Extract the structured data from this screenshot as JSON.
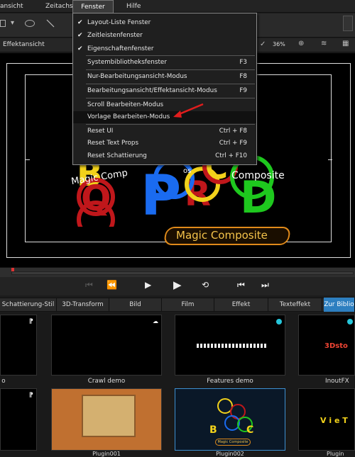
{
  "menubar": {
    "items": [
      "ansicht",
      "Zeitachse",
      "Fenster",
      "Hilfe"
    ],
    "active": "Fenster"
  },
  "tabbar": {
    "title": "Effektansicht",
    "zoom": "36%"
  },
  "dropdown": {
    "items": [
      {
        "label": "Layout-Liste Fenster",
        "checked": true,
        "shortcut": ""
      },
      {
        "label": "Zeitleistenfenster",
        "checked": true,
        "shortcut": ""
      },
      {
        "label": "Eigenschaftenfenster",
        "checked": true,
        "shortcut": ""
      },
      {
        "label": "Systembibliotheksfenster",
        "checked": false,
        "shortcut": "F3"
      },
      {
        "label": "Nur-Bearbeitungsansicht-Modus",
        "checked": false,
        "shortcut": "F8"
      },
      {
        "label": "Bearbeitungsansicht/Effektansicht-Modus",
        "checked": false,
        "shortcut": "F9"
      },
      {
        "label": "Scroll Bearbeiten-Modus",
        "checked": false,
        "shortcut": ""
      },
      {
        "label": "Vorlage Bearbeiten-Modus",
        "checked": false,
        "shortcut": ""
      },
      {
        "label": "Reset UI",
        "checked": false,
        "shortcut": "Ctrl + F8"
      },
      {
        "label": "Reset Text Props",
        "checked": false,
        "shortcut": "Ctrl + F9"
      },
      {
        "label": "Reset Schattierung",
        "checked": false,
        "shortcut": "Ctrl + F10"
      }
    ]
  },
  "preview": {
    "curve_text_left": "Magic Comp",
    "curve_text_mid": "os",
    "curve_text_right": "Composite",
    "banner_text": "Magic Composite",
    "letters": [
      "B",
      "C",
      "Q",
      "P",
      "R",
      "D"
    ]
  },
  "categories": [
    "Schattierung-Stil",
    "3D-Transform",
    "Bild",
    "Film",
    "Effekt",
    "Texteffekt",
    "Zur Biblio"
  ],
  "gallery": {
    "row1": [
      "o",
      "Crawl demo",
      "Features demo",
      "InoutFX"
    ],
    "row2": [
      "Plugin001",
      "Plugin002",
      "Plugin"
    ],
    "thumb_texts": {
      "inoutfx": "3Dsto",
      "vietnam": "V i e T",
      "small_banner": "Magic Composite"
    }
  },
  "colors": {
    "accent": "#2d7fc0",
    "highlight_dot": "#26c6da",
    "arrow": "#e11d1d",
    "banner": "#e08a1a"
  }
}
